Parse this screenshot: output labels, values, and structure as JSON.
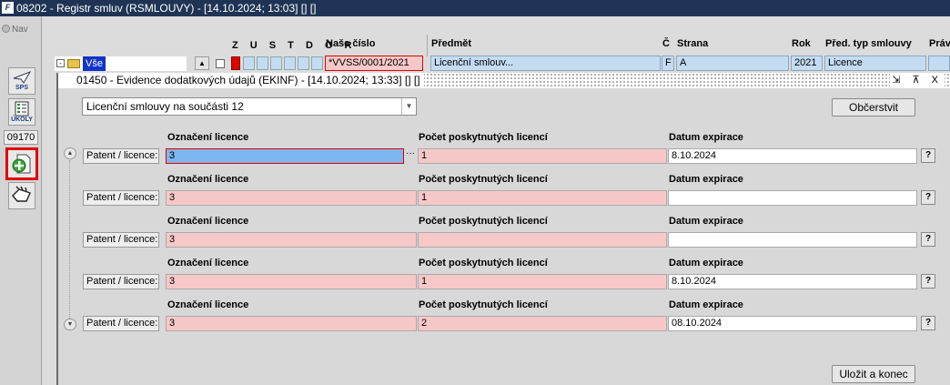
{
  "app": {
    "title": "08202 - Registr smluv (RSMLOUVY) - [14.10.2024; 13:03] [] []",
    "logo_text": "F"
  },
  "toolbar": {
    "nav_label": "Nav",
    "sps_label": "SPS",
    "ukoly_label": "ÚKOLY",
    "code": "09170"
  },
  "parent": {
    "tree_item": "Vše",
    "flags_header": "Z U S T D O R",
    "headers": {
      "cislo": "Naše číslo",
      "predmet": "Předmět",
      "c": "Č",
      "strana": "Strana",
      "rok": "Rok",
      "typ": "Před. typ smlouvy",
      "prav": "Práv"
    },
    "row": {
      "cislo": "*VVSS/0001/2021",
      "predmet": "Licenční smlouv...",
      "c": "F",
      "strana": "A",
      "rok": "2021",
      "typ": "Licence"
    }
  },
  "modal": {
    "title": "01450 - Evidence dodatkových údajů (EKINF) - [14.10.2024; 13:33] [] []",
    "window_buttons": "⇲ ⊼ X",
    "combo_value": "Licenční smlouvy na součásti 12",
    "refresh_button": "Občerstvit",
    "save_button": "Uložit a konec",
    "headers": {
      "oznaceni": "Označení licence",
      "pocet": "Počet poskytnutých licencí",
      "datum": "Datum expirace"
    },
    "row_label": "Patent / licence:",
    "help_label": "?",
    "lookup_label": "···",
    "rows": [
      {
        "oznaceni": "3",
        "pocet": "1",
        "datum": "8.10.2024"
      },
      {
        "oznaceni": "3",
        "pocet": "1",
        "datum": ""
      },
      {
        "oznaceni": "3",
        "pocet": "",
        "datum": ""
      },
      {
        "oznaceni": "3",
        "pocet": "1",
        "datum": "8.10.2024"
      },
      {
        "oznaceni": "3",
        "pocet": "2",
        "datum": "08.10.2024"
      }
    ]
  }
}
